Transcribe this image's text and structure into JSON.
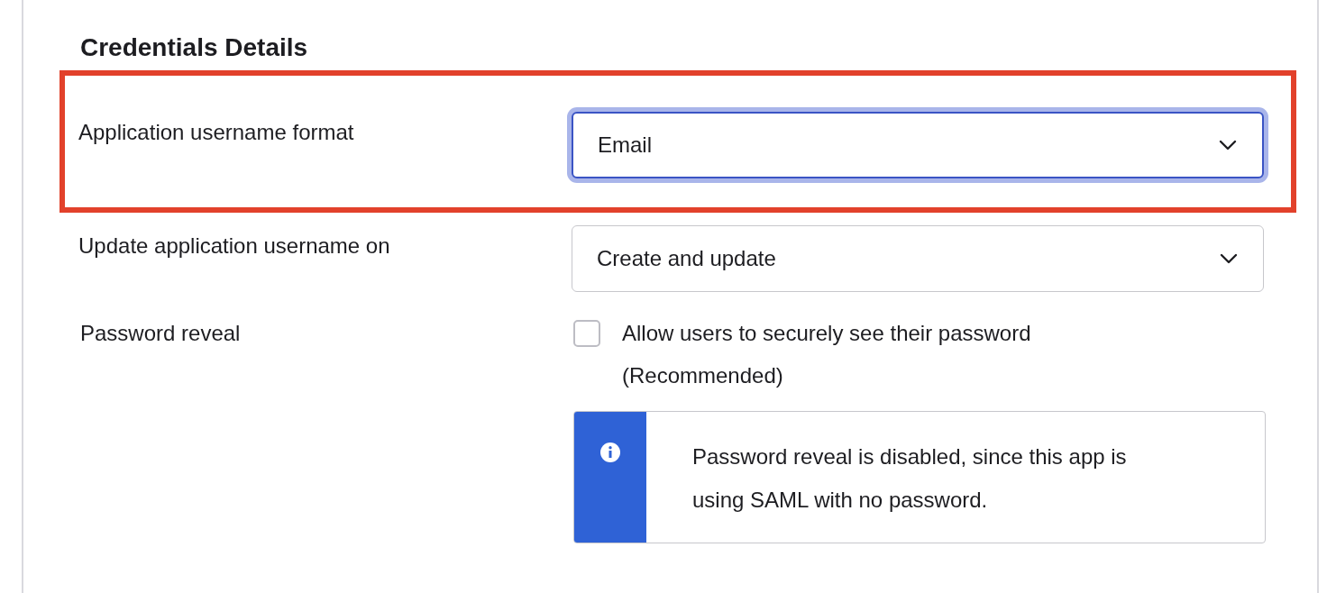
{
  "section_title": "Credentials Details",
  "fields": [
    {
      "label": "Application username format",
      "value": "Email",
      "focused": true,
      "highlighted": true
    },
    {
      "label": "Update application username on",
      "value": "Create and update",
      "focused": false,
      "highlighted": false
    }
  ],
  "password_reveal": {
    "label": "Password reveal",
    "checkbox_label": "Allow users to securely see their password (Recommended)",
    "checked": false,
    "notice": {
      "kind": "info",
      "text": "Password reveal is disabled, since this app is using SAML with no password."
    }
  }
}
